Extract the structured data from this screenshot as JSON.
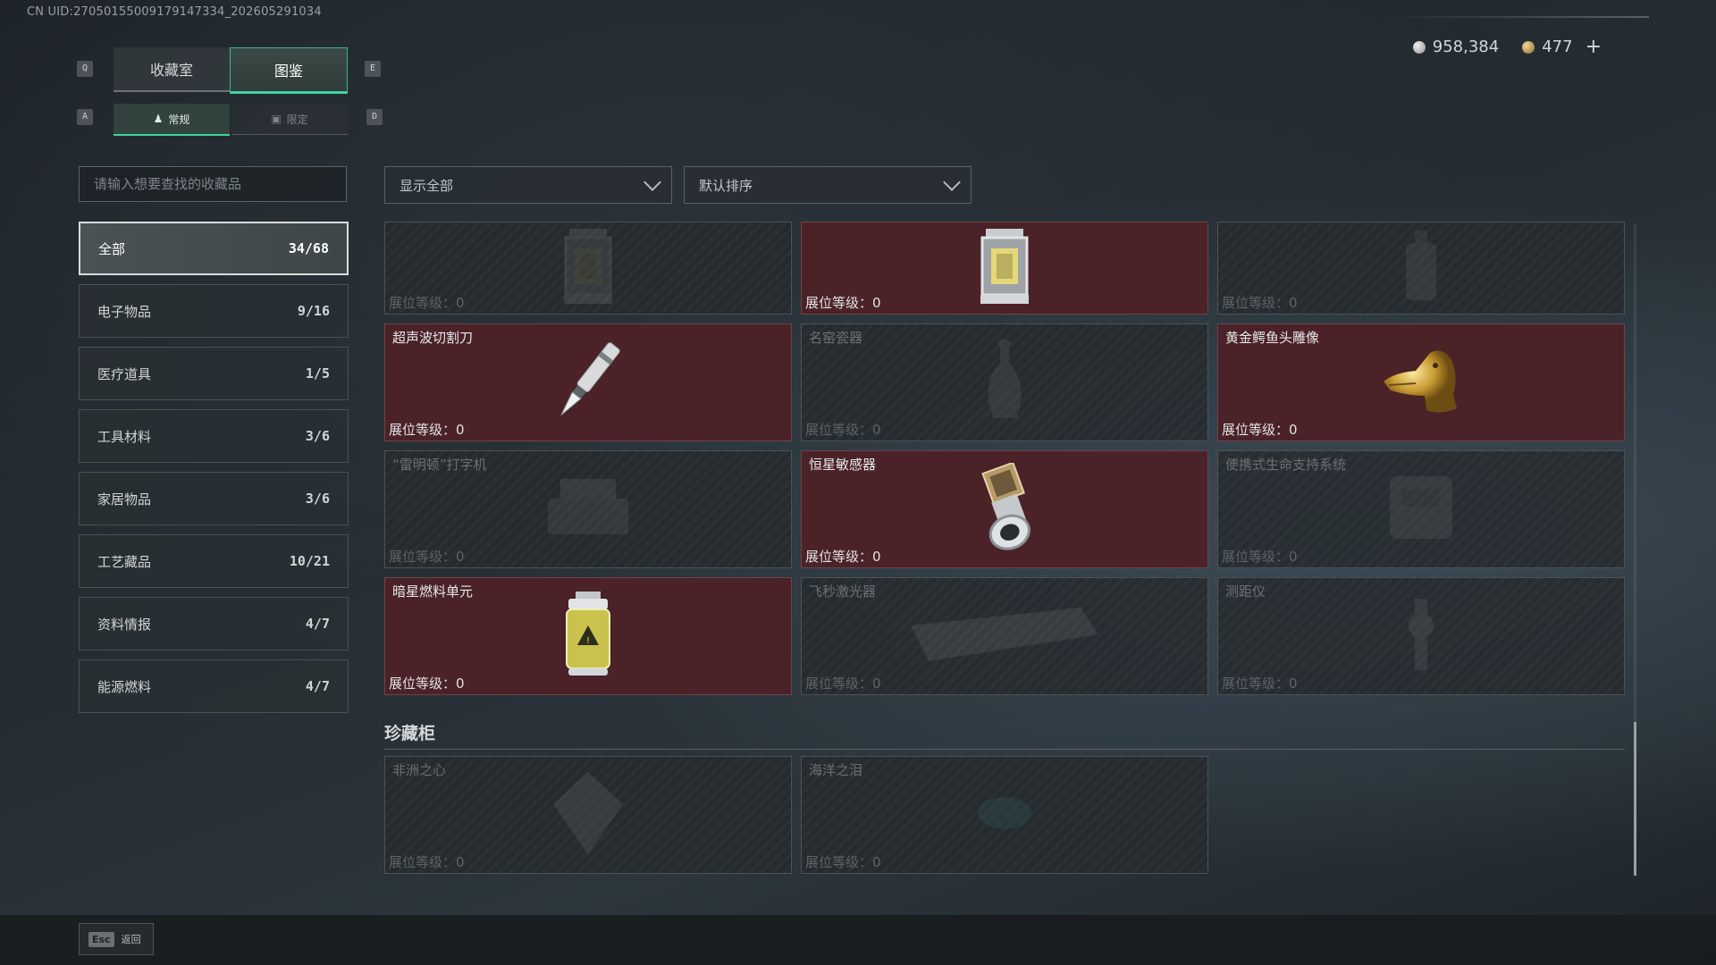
{
  "header": {
    "uid": "CN UID:2705015500917914733​4_202605291034",
    "silver": "958,384",
    "gold": "477",
    "plus": "+"
  },
  "keys": {
    "q": "Q",
    "e": "E",
    "a": "A",
    "d": "D",
    "esc": "Esc"
  },
  "tabs": {
    "collection_room": "收藏室",
    "catalog": "图鉴"
  },
  "subtabs": {
    "regular": "常规",
    "limited": "限定"
  },
  "search": {
    "placeholder": "请输入想要查找的收藏品"
  },
  "filters": {
    "show": "显示全部",
    "sort": "默认排序"
  },
  "categories": [
    {
      "label": "全部",
      "count": "34/68"
    },
    {
      "label": "电子物品",
      "count": "9/16"
    },
    {
      "label": "医疗道具",
      "count": "1/5"
    },
    {
      "label": "工具材料",
      "count": "3/6"
    },
    {
      "label": "家居物品",
      "count": "3/6"
    },
    {
      "label": "工艺藏品",
      "count": "10/21"
    },
    {
      "label": "资料情报",
      "count": "4/7"
    },
    {
      "label": "能源燃料",
      "count": "4/7"
    }
  ],
  "level_prefix": "展位等级：",
  "items": [
    {
      "name": "",
      "level": "0",
      "owned": false,
      "icon": "lantern-icon"
    },
    {
      "name": "",
      "level": "0",
      "owned": true,
      "icon": "lantern-icon"
    },
    {
      "name": "",
      "level": "0",
      "owned": false,
      "icon": "bottle-icon"
    },
    {
      "name": "超声波切割刀",
      "level": "0",
      "owned": true,
      "icon": "cutting-knife-icon"
    },
    {
      "name": "名窑瓷器",
      "level": "0",
      "owned": false,
      "icon": "porcelain-vase-icon"
    },
    {
      "name": "黄金鳄鱼头雕像",
      "level": "0",
      "owned": true,
      "icon": "gold-crocodile-icon"
    },
    {
      "name": "“雷明顿”打字机",
      "level": "0",
      "owned": false,
      "icon": "typewriter-icon"
    },
    {
      "name": "恒星敏感器",
      "level": "0",
      "owned": true,
      "icon": "star-sensor-icon"
    },
    {
      "name": "便携式生命支持系统",
      "level": "0",
      "owned": false,
      "icon": "life-support-icon"
    },
    {
      "name": "暗星燃料单元",
      "level": "0",
      "owned": true,
      "icon": "fuel-cell-icon"
    },
    {
      "name": "飞秒激光器",
      "level": "0",
      "owned": false,
      "icon": "laser-icon"
    },
    {
      "name": "测距仪",
      "level": "0",
      "owned": false,
      "icon": "rangefinder-icon"
    }
  ],
  "treasure": {
    "title": "珍藏柜",
    "items": [
      {
        "name": "非洲之心",
        "level": "0",
        "owned": false,
        "icon": "diamond-icon"
      },
      {
        "name": "海洋之泪",
        "level": "0",
        "owned": false,
        "icon": "gem-icon"
      }
    ]
  },
  "footer": {
    "back": "返回"
  },
  "colors": {
    "accent": "#3fd49b",
    "owned_bg": "#4a2227"
  }
}
